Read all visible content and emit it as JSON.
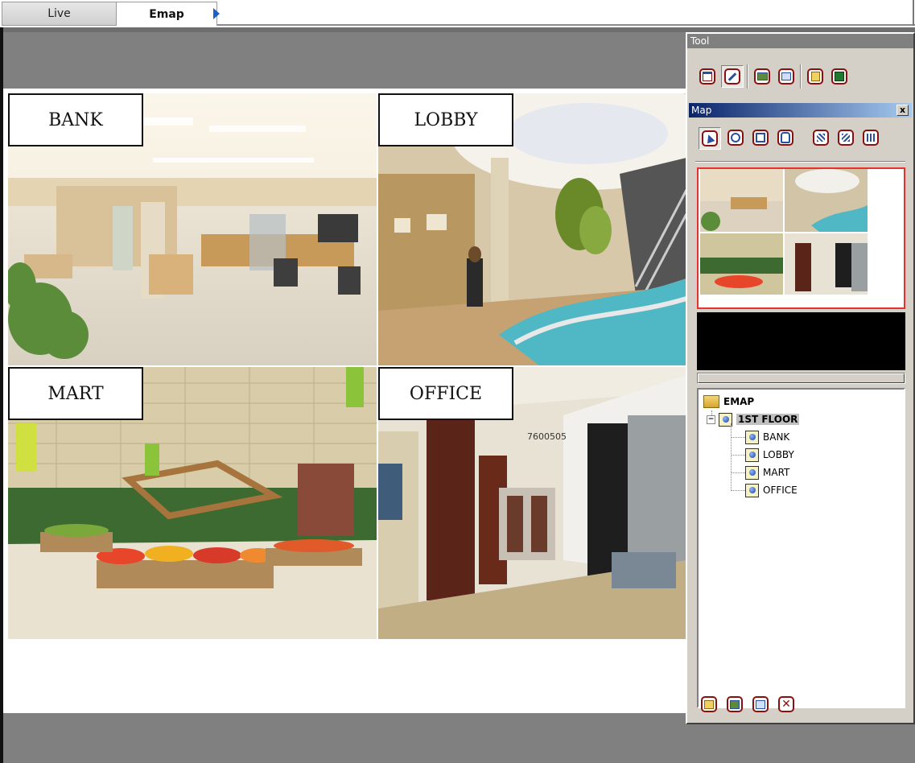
{
  "tabs": [
    {
      "label": "Live",
      "active": false
    },
    {
      "label": "Emap",
      "active": true
    }
  ],
  "scenes": [
    {
      "id": "bank",
      "label": "BANK"
    },
    {
      "id": "lobby",
      "label": "LOBBY"
    },
    {
      "id": "mart",
      "label": "MART"
    },
    {
      "id": "office",
      "label": "OFFICE"
    }
  ],
  "tool_panel": {
    "title": "Tool",
    "buttons": [
      "window-icon",
      "edit-icon",
      "image-icon",
      "edit-map-icon",
      "export-icon",
      "save-icon"
    ]
  },
  "map_panel": {
    "title": "Map",
    "close_label": "x",
    "tools": [
      "pointer-icon",
      "zoom-icon",
      "zoom-region-icon",
      "pan-hand-icon",
      "pattern-a-icon",
      "pattern-b-icon",
      "pattern-c-icon"
    ]
  },
  "tree": {
    "root": "EMAP",
    "floor": "1ST FLOOR",
    "items": [
      "BANK",
      "LOBBY",
      "MART",
      "OFFICE"
    ]
  },
  "bottom_buttons": [
    "add-map-icon",
    "add-item-icon",
    "edit-item-icon",
    "delete-icon"
  ],
  "colors": {
    "frame_gray": "#808080",
    "panel_bg": "#d4d0c8",
    "titlebar_blue": "#0a246a",
    "icon_red": "#8a1010",
    "thumbnail_border": "#e83030"
  }
}
